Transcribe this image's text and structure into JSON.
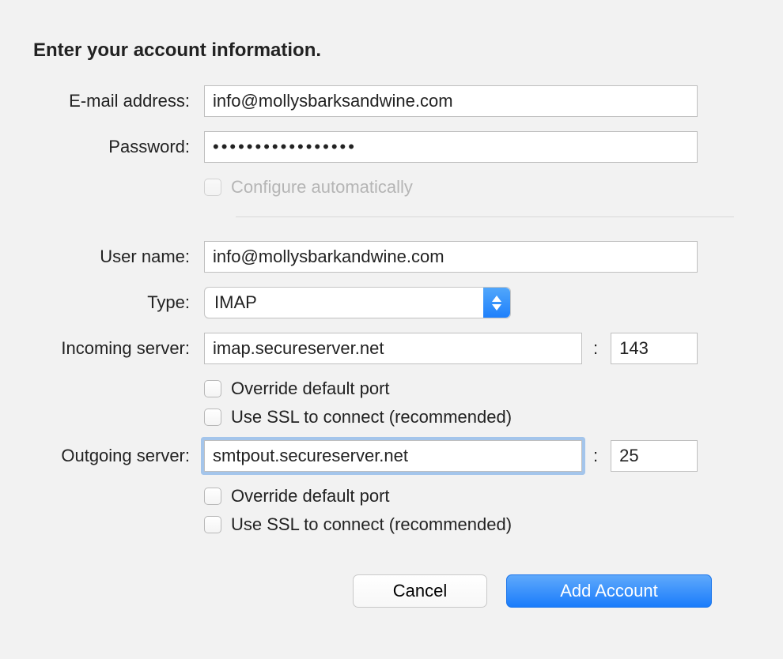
{
  "title": "Enter your account information.",
  "labels": {
    "email": "E-mail address:",
    "password": "Password:",
    "configure_auto": "Configure automatically",
    "username": "User name:",
    "type": "Type:",
    "incoming": "Incoming server:",
    "outgoing": "Outgoing server:",
    "override_port": "Override default port",
    "use_ssl": "Use SSL to connect (recommended)"
  },
  "values": {
    "email": "info@mollysbarksandwine.com",
    "password": "•••••••••••••••••",
    "username": "info@mollysbarkandwine.com",
    "type": "IMAP",
    "incoming_server": "imap.secureserver.net",
    "incoming_port": "143",
    "outgoing_server": "smtpout.secureserver.net",
    "outgoing_port": "25"
  },
  "buttons": {
    "cancel": "Cancel",
    "add": "Add Account"
  }
}
